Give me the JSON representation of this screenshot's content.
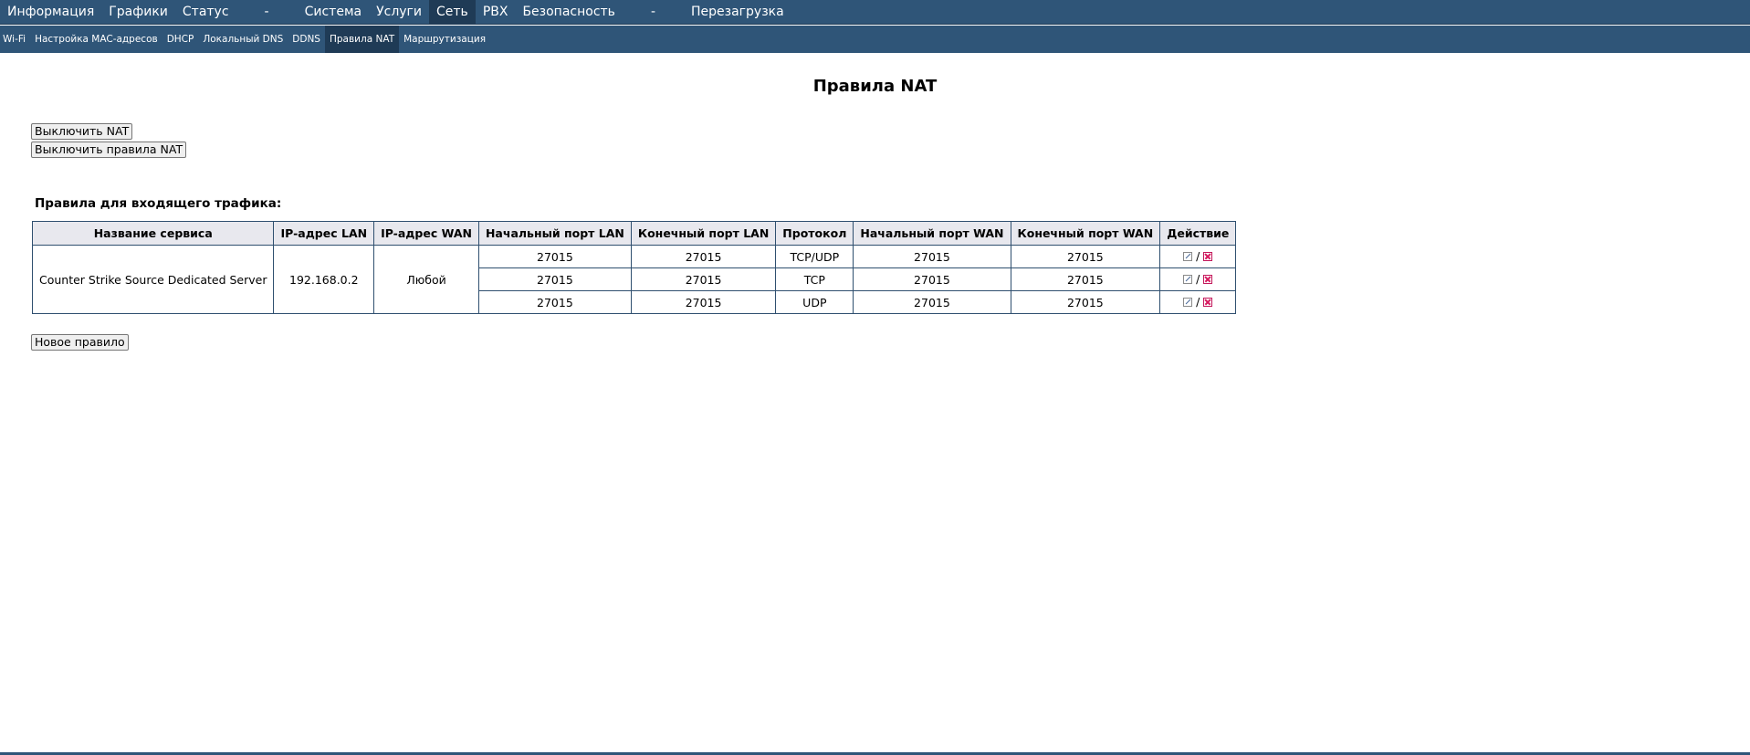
{
  "top_nav": {
    "items": [
      {
        "label": "Информация"
      },
      {
        "label": "Графики"
      },
      {
        "label": "Статус"
      },
      {
        "label": "-"
      },
      {
        "label": "Система"
      },
      {
        "label": "Услуги"
      },
      {
        "label": "Сеть",
        "active": true
      },
      {
        "label": "PBX"
      },
      {
        "label": "Безопасность"
      },
      {
        "label": "-"
      },
      {
        "label": "Перезагрузка"
      }
    ]
  },
  "sub_nav": {
    "items": [
      {
        "label": "Wi-Fi"
      },
      {
        "label": "Настройка MAC-адресов"
      },
      {
        "label": "DHCP"
      },
      {
        "label": "Локальный DNS"
      },
      {
        "label": "DDNS"
      },
      {
        "label": "Правила NAT",
        "active": true
      },
      {
        "label": "Маршрутизация"
      }
    ]
  },
  "page": {
    "title": "Правила NAT",
    "disable_nat_button": "Выключить NAT",
    "disable_rules_button": "Выключить правила NAT",
    "incoming_label": "Правила для входящего трафика:",
    "new_rule_button": "Новое правило"
  },
  "table": {
    "headers": [
      "Название сервиса",
      "IP-адрес LAN",
      "IP-адрес WAN",
      "Начальный порт LAN",
      "Конечный порт LAN",
      "Протокол",
      "Начальный порт WAN",
      "Конечный порт WAN",
      "Действие"
    ],
    "service": "Counter Strike Source Dedicated Server",
    "lan_ip": "192.168.0.2",
    "wan_ip": "Любой",
    "rows": [
      {
        "lan_start": "27015",
        "lan_end": "27015",
        "protocol": "TCP/UDP",
        "wan_start": "27015",
        "wan_end": "27015"
      },
      {
        "lan_start": "27015",
        "lan_end": "27015",
        "protocol": "TCP",
        "wan_start": "27015",
        "wan_end": "27015"
      },
      {
        "lan_start": "27015",
        "lan_end": "27015",
        "protocol": "UDP",
        "wan_start": "27015",
        "wan_end": "27015"
      }
    ],
    "action_separator": "/",
    "action_icons": [
      "edit-icon",
      "delete-icon"
    ]
  },
  "colors": {
    "nav_bg": "#2f5578",
    "nav_active_bg": "#1f3b56",
    "table_border": "#2f4f6f",
    "header_bg": "#e8e8ee",
    "delete_icon": "#d81b60"
  }
}
